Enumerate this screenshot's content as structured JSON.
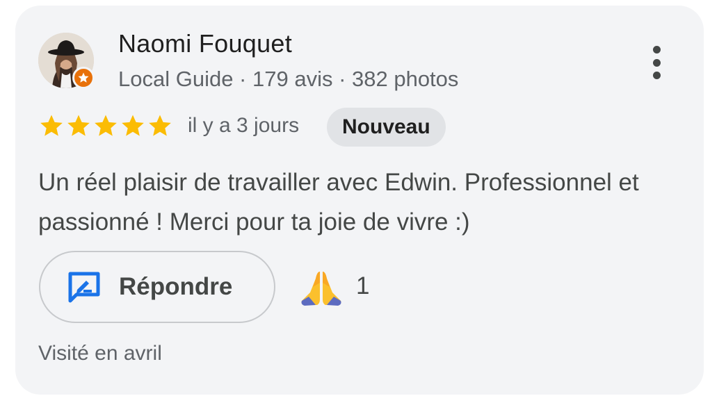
{
  "reviewer": {
    "name": "Naomi Fouquet",
    "meta": "Local Guide · 179 avis · 382 photos"
  },
  "review": {
    "rating": 5,
    "rating_max": 5,
    "time": "il y a 3 jours",
    "badge": "Nouveau",
    "text": "Un réel plaisir de travailler avec Edwin. Professionnel et passionné ! Merci pour ta joie de vivre :)",
    "visited": "Visité en avril"
  },
  "actions": {
    "reply_label": "Répondre",
    "reaction_count": "1"
  },
  "icons": {
    "more": "more-vert-icon",
    "reply": "rate-review-icon",
    "reaction": "folded-hands-icon",
    "badge": "local-guide-star-icon"
  },
  "colors": {
    "star": "#fbbc04",
    "badge": "#e8710a",
    "reply_icon": "#1a73e8",
    "card_bg": "#f3f4f6"
  }
}
